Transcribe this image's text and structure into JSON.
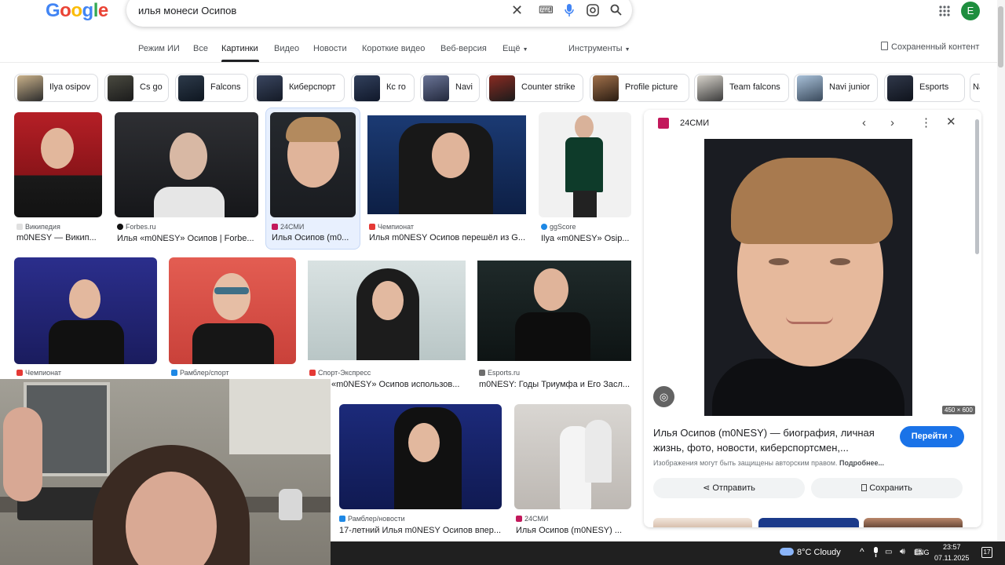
{
  "header": {
    "logo_text": "Google",
    "search_query": "илья монеси Осипов",
    "avatar_letter": "E",
    "saved_content": "Сохраненный контент"
  },
  "tabs": [
    "Режим ИИ",
    "Все",
    "Картинки",
    "Видео",
    "Новости",
    "Короткие видео",
    "Веб-версия",
    "Ещё",
    "Инструменты"
  ],
  "chips": [
    "Ilya osipov",
    "Cs go",
    "Falcons",
    "Киберспорт",
    "Кс го",
    "Navi",
    "Counter strike",
    "Profile picture",
    "Team falcons",
    "Navi junior",
    "Esports",
    "Na"
  ],
  "results": [
    {
      "source": "Википедия",
      "title": "m0NESY — Викип..."
    },
    {
      "source": "Forbes.ru",
      "title": "Илья «m0NESY» Осипов | Forbe..."
    },
    {
      "source": "24СМИ",
      "title": "Илья Осипов (m0..."
    },
    {
      "source": "Чемпионат",
      "title": "Илья m0NESY Осипов перешёл из G..."
    },
    {
      "source": "ggScore",
      "title": "Ilya «m0NESY» Osip..."
    },
    {
      "source": "Чемпионат",
      "title": ""
    },
    {
      "source": "Рамблер/спорт",
      "title": ""
    },
    {
      "source": "Спорт-Экспресс",
      "title": "«m0NESY» Осипов использов..."
    },
    {
      "source": "Esports.ru",
      "title": "m0NESY: Годы Триумфа и Его Засл..."
    },
    {
      "source": "Рамблер/новости",
      "title": "17-летний Илья m0NESY Осипов впер..."
    },
    {
      "source": "24СМИ",
      "title": "Илья Осипов (m0NESY) ..."
    }
  ],
  "panel": {
    "source": "24СМИ",
    "dimensions": "450 × 600",
    "title": "Илья Осипов (m0NESY) — биография, личная жизнь, фото, новости, киберспортсмен,...",
    "go_button": "Перейти",
    "copyright": "Изображения могут быть защищены авторским правом.",
    "copyright_more": "Подробнее...",
    "share_button": "Отправить",
    "save_button": "Сохранить"
  },
  "taskbar": {
    "weather": "8°C  Cloudy",
    "lang": "ENG",
    "time": "23:57",
    "date": "07.11.2025",
    "notifications": "17"
  },
  "colors": {
    "accent": "#1a73e8",
    "selected_bg": "#e8f0fe",
    "taskbar": "#202020"
  }
}
